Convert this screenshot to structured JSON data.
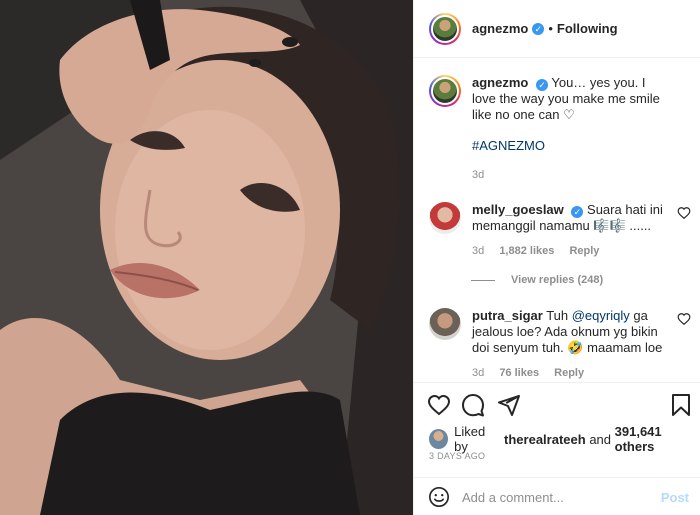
{
  "post": {
    "author": "agnezmo",
    "follow_status": "Following",
    "dot": "•"
  },
  "caption": {
    "author": "agnezmo",
    "text": "You… yes you. I love the way you make me smile like no one can ♡",
    "hashtag": "#AGNEZMO",
    "age": "3d"
  },
  "comments": [
    {
      "author": "melly_goeslaw",
      "verified": true,
      "text": "Suara hati ini memanggil namamu 🎼🎼 ......",
      "age": "3d",
      "likes": "1,882 likes",
      "reply": "Reply",
      "view_replies": "View replies (248)"
    },
    {
      "author": "putra_sigar",
      "verified": false,
      "text_pre": "Tuh ",
      "mention": "@eqyriqly",
      "text_post": " ga jealous loe? Ada oknum yg bikin doi senyum tuh. 🤣 maamam loe",
      "age": "3d",
      "likes": "76 likes",
      "reply": "Reply"
    }
  ],
  "likes": {
    "prefix": "Liked by",
    "user": "therealrateeh",
    "and": "and",
    "count": "391,641 others"
  },
  "date": "3 DAYS AGO",
  "comment_box": {
    "placeholder": "Add a comment...",
    "post_label": "Post"
  },
  "icons": {
    "like": "heart-icon",
    "comment": "comment-icon",
    "share": "share-icon",
    "save": "bookmark-icon",
    "emoji": "emoji-icon",
    "verified": "verified-icon"
  },
  "colors": {
    "link": "#00376b",
    "verified": "#3897f0",
    "muted": "#8e8e8e",
    "post_disabled": "#b3dbff"
  }
}
